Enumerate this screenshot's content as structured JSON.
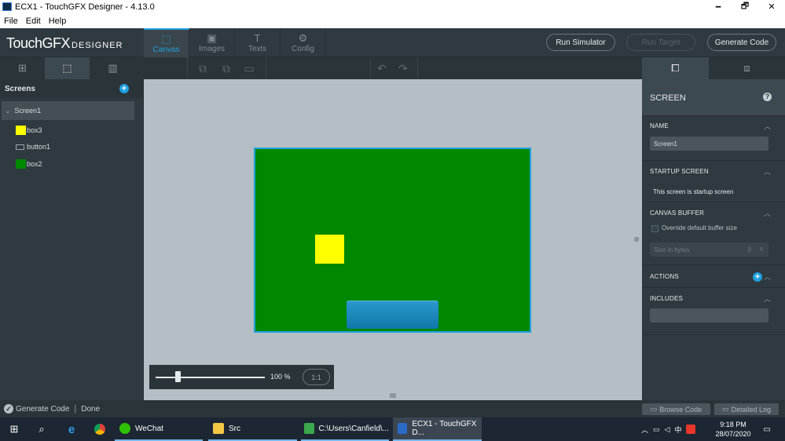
{
  "window": {
    "title": "ECX1 - TouchGFX Designer - 4.13.0",
    "minimize_glyph": "🗕",
    "restore_glyph": "🗗",
    "close_glyph": "✕"
  },
  "menu": [
    "File",
    "Edit",
    "Help"
  ],
  "logo": {
    "main": "TouchGFX",
    "sub": "DESIGNER"
  },
  "tabs": [
    {
      "label": "Canvas",
      "icon": "canvas-icon",
      "glyph": "⬚"
    },
    {
      "label": "Images",
      "icon": "images-icon",
      "glyph": "▣"
    },
    {
      "label": "Texts",
      "icon": "texts-icon",
      "glyph": "T"
    },
    {
      "label": "Config",
      "icon": "config-icon",
      "glyph": "⚙"
    }
  ],
  "actions": {
    "run_simulator": "Run Simulator",
    "run_target": "Run Target",
    "generate_code": "Generate Code"
  },
  "left_panel": {
    "title": "Screens",
    "screen": "Screen1",
    "widgets": [
      {
        "name": "box3",
        "color": "#ffff00",
        "kind": "box"
      },
      {
        "name": "button1",
        "kind": "button"
      },
      {
        "name": "box2",
        "color": "#008800",
        "kind": "box"
      }
    ]
  },
  "canvas": {
    "zoom": "100 %",
    "zoom_reset": "1:1",
    "zoom_slider_level": 0.2,
    "screen_color": "#008800",
    "box3_color": "#ffff00"
  },
  "properties": {
    "header": "SCREEN",
    "help": "?",
    "name_label": "NAME",
    "name_value": "Screen1",
    "startup_label": "STARTUP SCREEN",
    "startup_text": "This screen is startup screen",
    "buffer_label": "CANVAS BUFFER",
    "override_label": "Override default buffer size",
    "size_placeholder": "Size in bytes",
    "size_value": "0",
    "actions_label": "ACTIONS",
    "includes_label": "INCLUDES"
  },
  "status": {
    "task": "Generate Code",
    "state": "Done",
    "browse_code": "Browse Code",
    "detailed_log": "Detailed Log"
  },
  "taskbar": {
    "apps": [
      {
        "label": "WeChat",
        "color": "#2dc100"
      },
      {
        "label": "Src",
        "color": "#f2c744"
      },
      {
        "label": "C:\\Users\\Canfield\\...",
        "color": "#3aa84c"
      },
      {
        "label": "ECX1 - TouchGFX D...",
        "color": "#2a6bc5"
      }
    ],
    "ime": "中",
    "time": "9:18 PM",
    "date": "28/07/2020"
  }
}
